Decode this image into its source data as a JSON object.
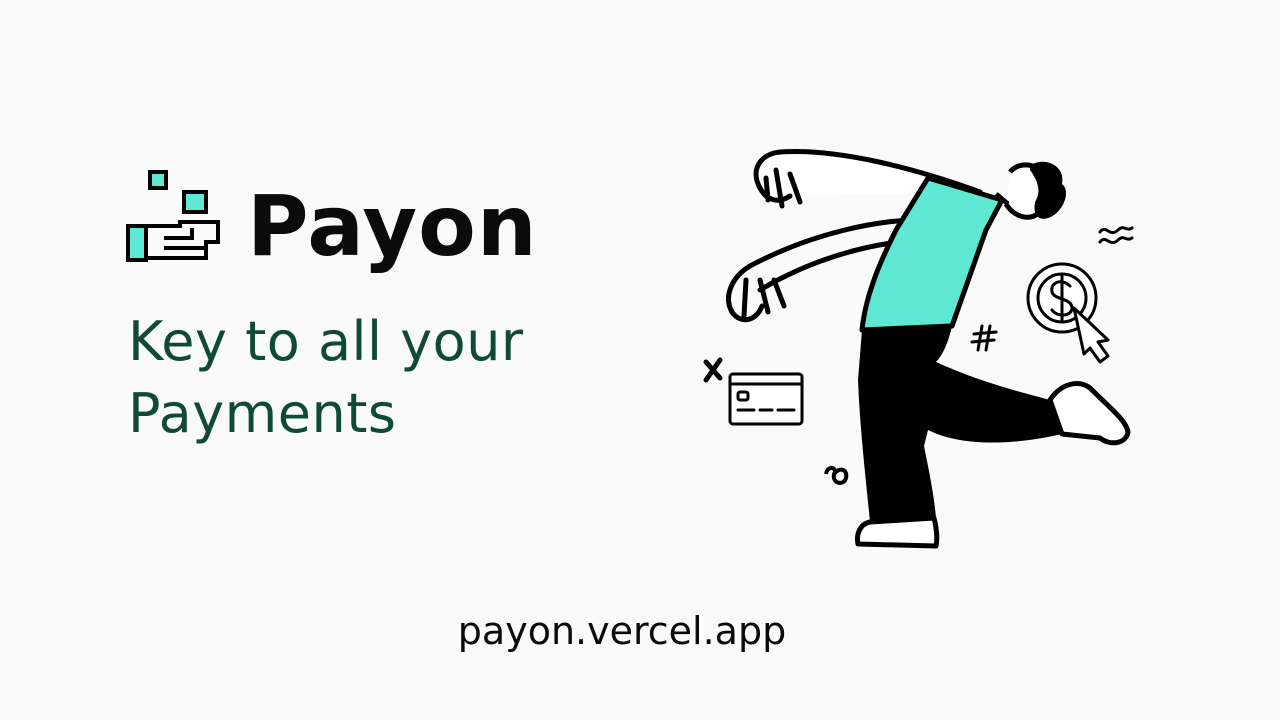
{
  "brand": {
    "name": "Payon",
    "logo_icon": "hand-with-coins-pixel-icon",
    "accent_color": "#5ee8d4"
  },
  "tagline": {
    "line1": "Key to all your",
    "line2": "Payments",
    "color": "#0e4a34"
  },
  "url": "payon.vercel.app",
  "illustration": {
    "name": "running-person-illustration",
    "shirt_color": "#5ee8d4",
    "pants_color": "#000000",
    "props": [
      "credit-card-icon",
      "dollar-coin-cursor-icon",
      "hash-doodle",
      "x-doodle",
      "spiral-doodle",
      "squiggle-doodle"
    ]
  }
}
